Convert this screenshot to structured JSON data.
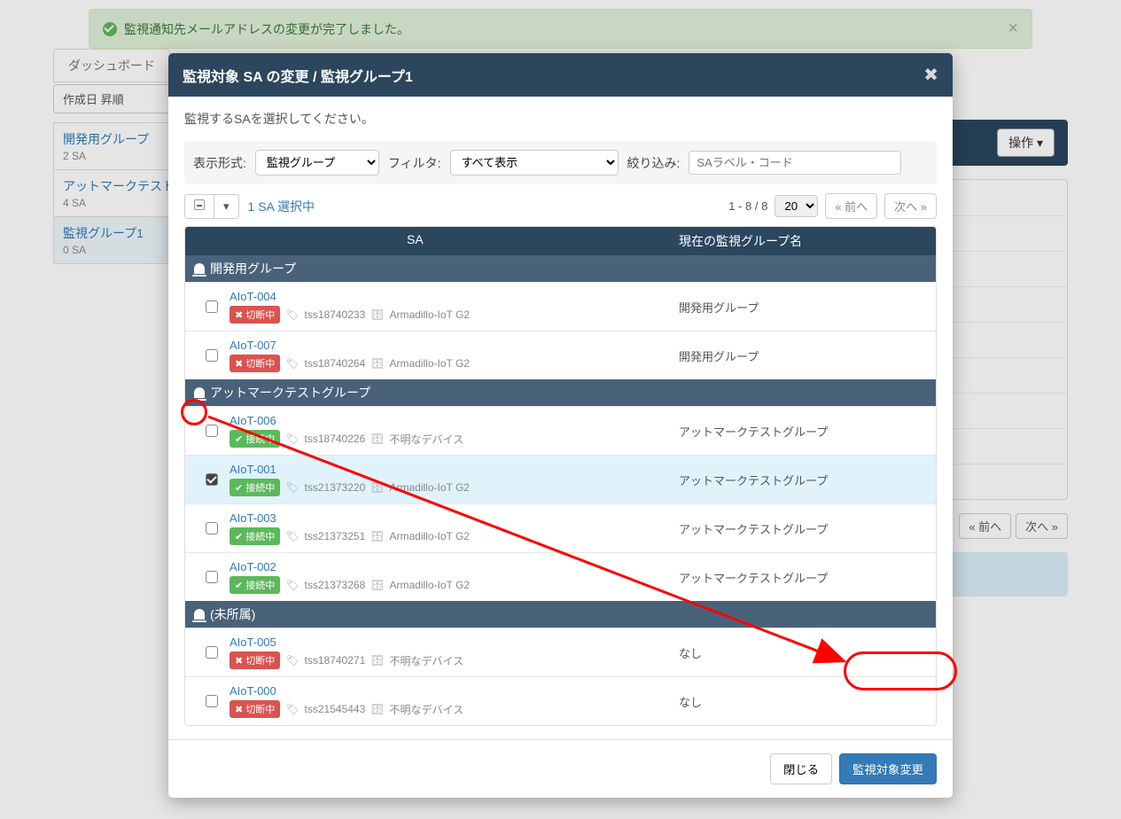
{
  "alert": {
    "message": "監視通知先メールアドレスの変更が完了しました。"
  },
  "tabs": {
    "dashboard": "ダッシュボード"
  },
  "sidebar": {
    "sort_label": "作成日 昇順",
    "groups": [
      {
        "name": "開発用グループ",
        "count": "2 SA"
      },
      {
        "name": "アットマークテスト",
        "count": "4 SA"
      },
      {
        "name": "監視グループ1",
        "count": "0 SA"
      }
    ]
  },
  "opsButton": "操作 ▾",
  "bg_pager": {
    "prev": "« 前へ",
    "next": "次へ »"
  },
  "modal": {
    "title": "監視対象 SA の変更 / 監視グループ1",
    "instruction": "監視するSAを選択してください。",
    "filters": {
      "display_label": "表示形式:",
      "display_value": "監視グループ",
      "filter_label": "フィルタ:",
      "filter_value": "すべて表示",
      "search_label": "絞り込み:",
      "search_placeholder": "SAラベル・コード"
    },
    "toolbar": {
      "selected_info": "1 SA 選択中",
      "range": "1 - 8 / 8",
      "page_size": "20",
      "prev": "« 前へ",
      "next": "次へ »"
    },
    "columns": {
      "sa": "SA",
      "group": "現在の監視グループ名"
    },
    "groups": [
      {
        "name": "開発用グループ",
        "rows": [
          {
            "id": "AIoT-004",
            "status": "切断中",
            "status_type": "red",
            "tag": "tss18740233",
            "device": "Armadillo-IoT G2",
            "group": "開発用グループ",
            "checked": false
          },
          {
            "id": "AIoT-007",
            "status": "切断中",
            "status_type": "red",
            "tag": "tss18740264",
            "device": "Armadillo-IoT G2",
            "group": "開発用グループ",
            "checked": false
          }
        ]
      },
      {
        "name": "アットマークテストグループ",
        "rows": [
          {
            "id": "AIoT-006",
            "status": "接続中",
            "status_type": "green",
            "tag": "tss18740226",
            "device": "不明なデバイス",
            "group": "アットマークテストグループ",
            "checked": false
          },
          {
            "id": "AIoT-001",
            "status": "接続中",
            "status_type": "green",
            "tag": "tss21373220",
            "device": "Armadillo-IoT G2",
            "group": "アットマークテストグループ",
            "checked": true
          },
          {
            "id": "AIoT-003",
            "status": "接続中",
            "status_type": "green",
            "tag": "tss21373251",
            "device": "Armadillo-IoT G2",
            "group": "アットマークテストグループ",
            "checked": false
          },
          {
            "id": "AIoT-002",
            "status": "接続中",
            "status_type": "green",
            "tag": "tss21373268",
            "device": "Armadillo-IoT G2",
            "group": "アットマークテストグループ",
            "checked": false
          }
        ]
      },
      {
        "name": "(未所属)",
        "rows": [
          {
            "id": "AIoT-005",
            "status": "切断中",
            "status_type": "red",
            "tag": "tss18740271",
            "device": "不明なデバイス",
            "group": "なし",
            "checked": false
          },
          {
            "id": "AIoT-000",
            "status": "切断中",
            "status_type": "red",
            "tag": "tss21545443",
            "device": "不明なデバイス",
            "group": "なし",
            "checked": false
          }
        ]
      }
    ],
    "footer": {
      "close": "閉じる",
      "submit": "監視対象変更"
    }
  },
  "status_prefix": {
    "red": "✖ ",
    "green": "✔ "
  }
}
